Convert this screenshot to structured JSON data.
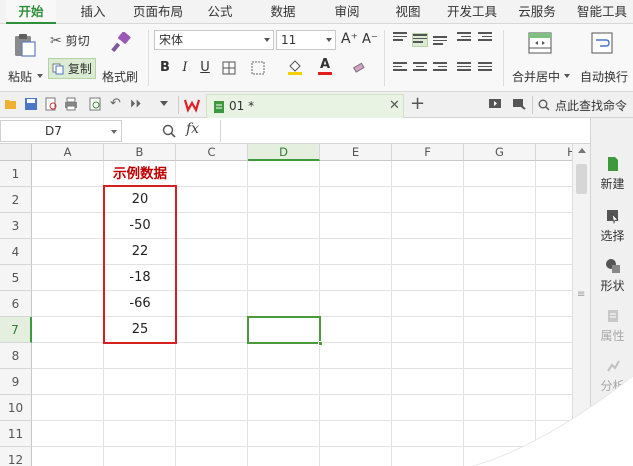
{
  "tabs": [
    "开始",
    "插入",
    "页面布局",
    "公式",
    "数据",
    "审阅",
    "视图",
    "开发工具",
    "云服务",
    "智能工具"
  ],
  "ribbon": {
    "paste_label": "粘贴",
    "cut_label": "剪切",
    "copy_label": "复制",
    "format_painter_label": "格式刷",
    "font_name": "宋体",
    "font_size": "11",
    "grow_font": "A⁺",
    "shrink_font": "A⁻",
    "bold": "B",
    "italic": "I",
    "underline": "U",
    "merge_center_label": "合并居中",
    "wrap_text_label": "自动换行"
  },
  "quickbar": {
    "doc_tab_label": "01 *",
    "search_label": "点此查找命令"
  },
  "formula_bar": {
    "name_box": "D7",
    "fx_label": "fx",
    "formula_value": ""
  },
  "sheet": {
    "columns": [
      "A",
      "B",
      "C",
      "D",
      "E",
      "F",
      "G",
      "H"
    ],
    "rows": [
      "1",
      "2",
      "3",
      "4",
      "5",
      "6",
      "7",
      "8",
      "9",
      "10",
      "11",
      "12"
    ],
    "selected_column": "D",
    "selected_row": "7",
    "b1_title": "示例数据",
    "b_values": [
      "20",
      "-50",
      "22",
      "-18",
      "-66",
      "25"
    ]
  },
  "task_pane": {
    "items": [
      {
        "label": "新建",
        "enabled": true
      },
      {
        "label": "选择",
        "enabled": true
      },
      {
        "label": "形状",
        "enabled": true
      },
      {
        "label": "属性",
        "enabled": false
      },
      {
        "label": "分析",
        "enabled": false
      }
    ]
  },
  "colors": {
    "accent_green": "#2f8f3a",
    "highlight_red": "#d42020",
    "title_red": "#c00000"
  }
}
